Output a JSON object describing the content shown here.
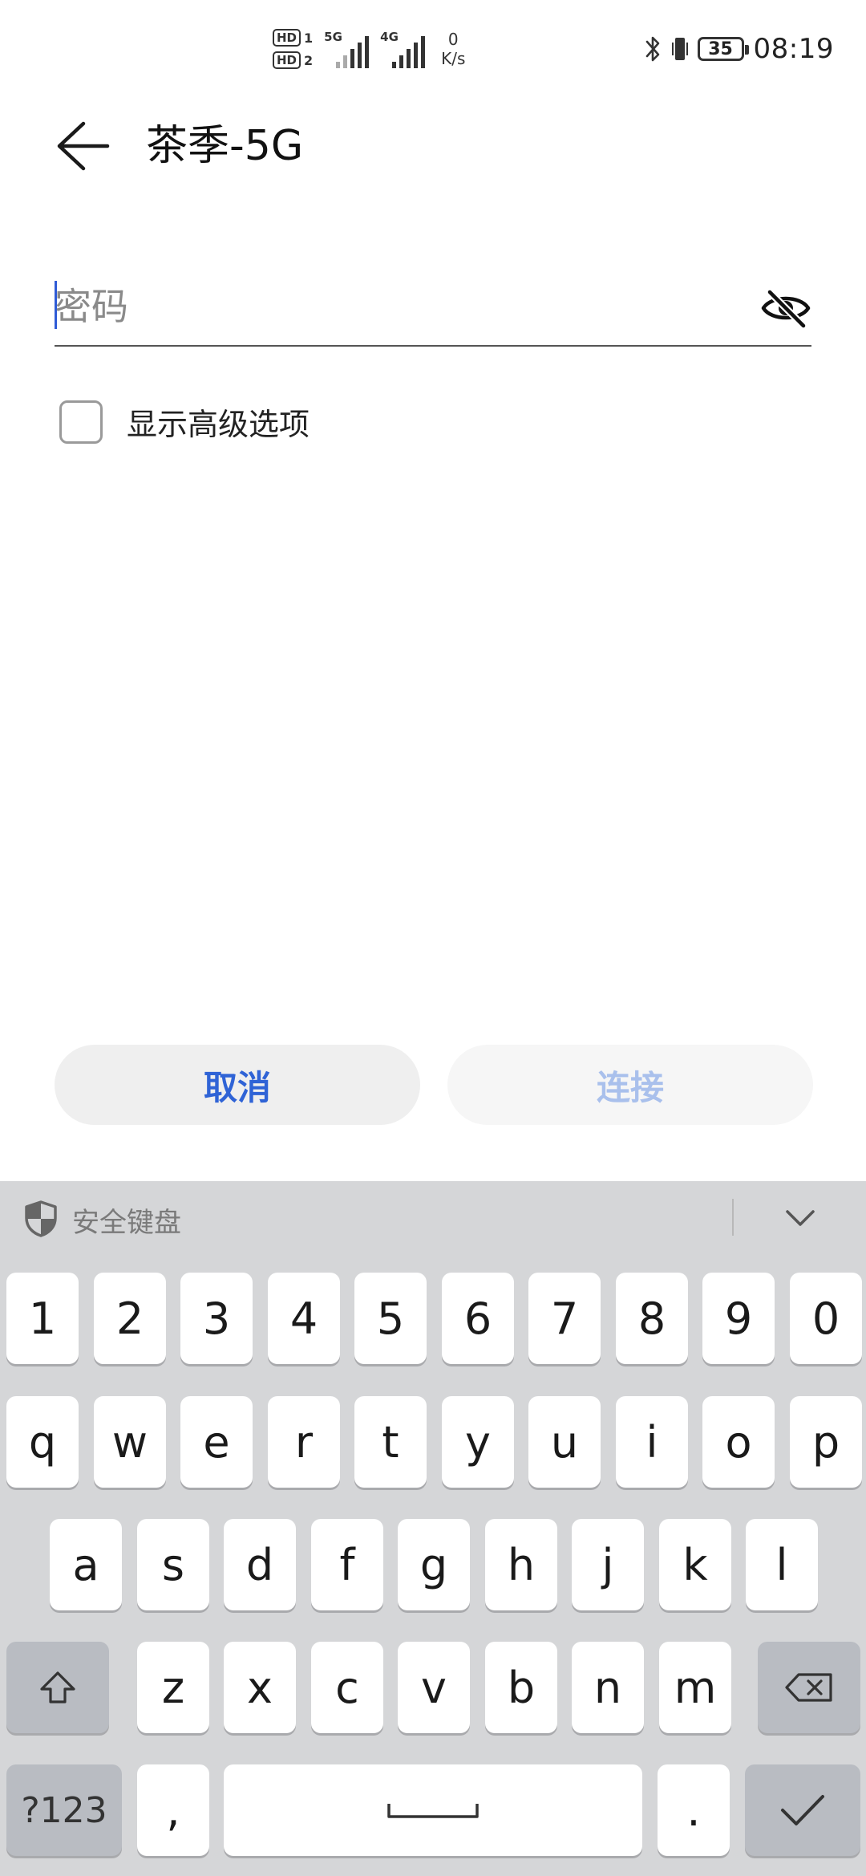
{
  "status_bar": {
    "hd1": "HD",
    "hd1_sub": "1",
    "hd2": "HD",
    "hd2_sub": "2",
    "net1": "5G",
    "net2": "4G",
    "speed_value": "0",
    "speed_unit": "K/s",
    "battery_level": "35",
    "time": "08:19"
  },
  "header": {
    "title": "茶季-5G"
  },
  "password": {
    "placeholder": "密码",
    "value": ""
  },
  "advanced": {
    "label": "显示高级选项",
    "checked": false
  },
  "buttons": {
    "cancel": "取消",
    "connect": "连接"
  },
  "keyboard": {
    "title": "安全键盘",
    "row_numbers": [
      "1",
      "2",
      "3",
      "4",
      "5",
      "6",
      "7",
      "8",
      "9",
      "0"
    ],
    "row_top": [
      "q",
      "w",
      "e",
      "r",
      "t",
      "y",
      "u",
      "i",
      "o",
      "p"
    ],
    "row_middle": [
      "a",
      "s",
      "d",
      "f",
      "g",
      "h",
      "j",
      "k",
      "l"
    ],
    "row_bottom": [
      "z",
      "x",
      "c",
      "v",
      "b",
      "n",
      "m"
    ],
    "symbols_key": "?123",
    "comma_key": ",",
    "period_key": "."
  },
  "colors": {
    "accent": "#2f63d6",
    "accent_disabled": "#a9c0ec",
    "keyboard_bg": "#d5d6d8",
    "key_dark": "#b9bcc2"
  }
}
